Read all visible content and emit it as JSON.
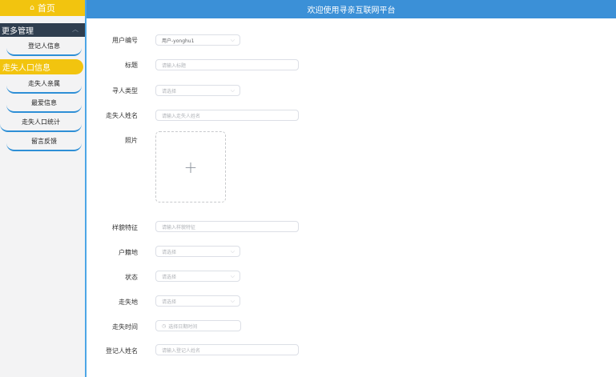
{
  "sidebar": {
    "home": "首页",
    "section_header": "更多管理",
    "section_items": [
      "登记人信息"
    ],
    "active_header": "走失人口信息",
    "items": [
      "走失人亲属",
      "最爱信息",
      "走失人口统计",
      "留言反馈"
    ]
  },
  "topbar": {
    "title": "欢迎使用寻亲互联网平台"
  },
  "form": {
    "user_id": {
      "label": "用户编号",
      "value": "用户-yonghu1"
    },
    "title": {
      "label": "标题",
      "placeholder": "请输入标题"
    },
    "seek_type": {
      "label": "寻人类型",
      "placeholder": "请选择"
    },
    "missing_name": {
      "label": "走失人姓名",
      "placeholder": "请输入走失人姓名"
    },
    "photo": {
      "label": "照片",
      "upload_symbol": "+"
    },
    "features": {
      "label": "样貌特征",
      "placeholder": "请输入样貌特征"
    },
    "household": {
      "label": "户籍地",
      "placeholder": "请选择"
    },
    "status": {
      "label": "状态",
      "placeholder": "请选择"
    },
    "missing_place": {
      "label": "走失地",
      "placeholder": "请选择"
    },
    "missing_time": {
      "label": "走失时间",
      "placeholder": "选择日期时间"
    },
    "registrant_name": {
      "label": "登记人姓名",
      "placeholder": "请输入登记人姓名"
    }
  }
}
